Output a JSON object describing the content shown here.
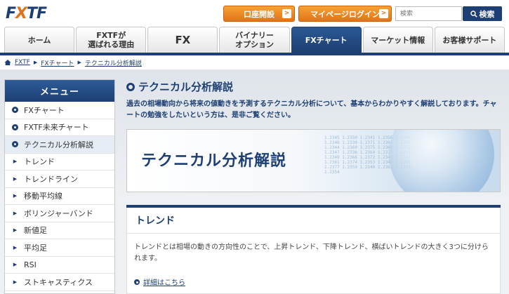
{
  "header": {
    "logo_left": "F",
    "logo_x": "X",
    "logo_right": "TF",
    "open_account": "口座開設",
    "my_login": "マイページログイン",
    "search_placeholder": "検索",
    "search_button": "検索",
    "arrow": ">"
  },
  "nav": [
    {
      "label": "ホーム"
    },
    {
      "label": "FXTFが\n選ばれる理由"
    },
    {
      "label": "FX"
    },
    {
      "label": "バイナリー\nオプション"
    },
    {
      "label": "FXチャート"
    },
    {
      "label": "マーケット情報"
    },
    {
      "label": "お客様サポート"
    }
  ],
  "breadcrumb": {
    "items": [
      "FXTF",
      "FXチャート",
      "テクニカル分析解説"
    ],
    "sep": "▶"
  },
  "sidebar": {
    "title": "メニュー",
    "items": [
      {
        "label": "FXチャート"
      },
      {
        "label": "FXTF未来チャート"
      },
      {
        "label": "テクニカル分析解説"
      },
      {
        "label": "トレンド"
      },
      {
        "label": "トレンドライン"
      },
      {
        "label": "移動平均線"
      },
      {
        "label": "ボリンジャーバンド"
      },
      {
        "label": "新値足"
      },
      {
        "label": "平均足"
      },
      {
        "label": "RSI"
      },
      {
        "label": "ストキャスティクス"
      }
    ]
  },
  "main": {
    "title": "テクニカル分析解説",
    "intro": "過去の相場動向から将来の値動きを予測するテクニカル分析について、基本からわかりやすく解説しております。チャートの勉強をしたいという方は、是非ご覧ください。",
    "hero_title": "テクニカル分析解説",
    "section_title": "トレンド",
    "section_text": "トレンドとは相場の動きの方向性のことで、上昇トレンド、下降トレンド、横ばいトレンドの大きく3つに分けられます。",
    "more_link": "詳細はこちら"
  },
  "colors": {
    "brand_navy": "#1d3f73",
    "accent_orange": "#e0741a"
  }
}
